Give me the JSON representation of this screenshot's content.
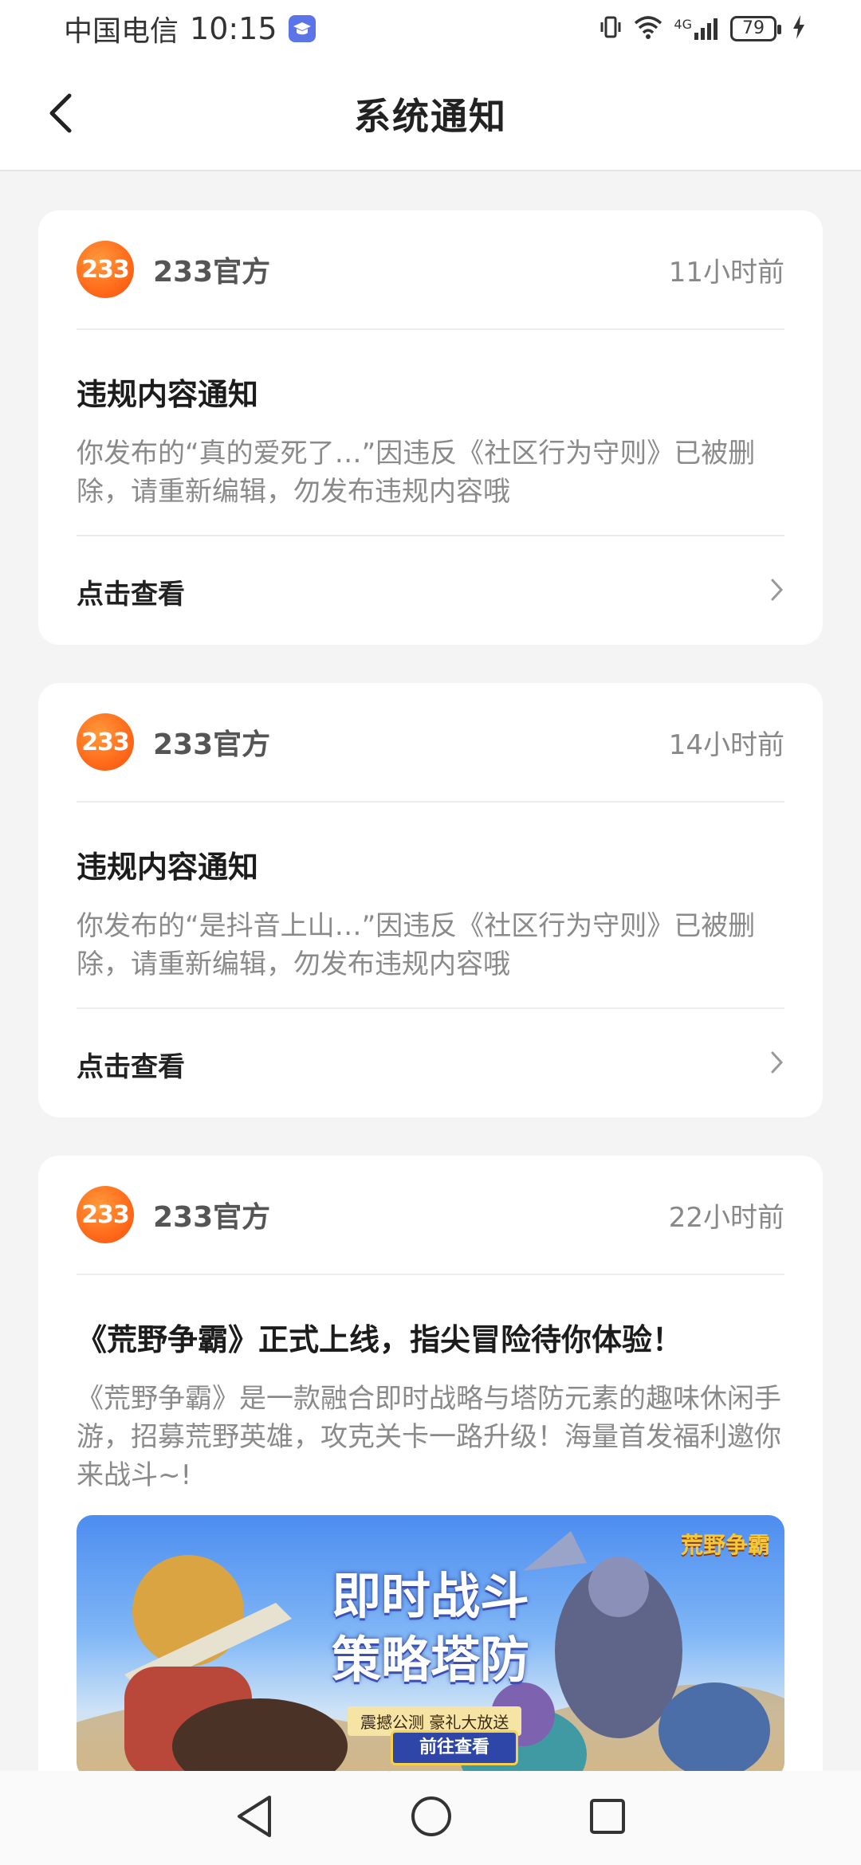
{
  "status_bar": {
    "carrier": "中国电信",
    "time": "10:15",
    "network": "4G",
    "battery": "79"
  },
  "header": {
    "title": "系统通知"
  },
  "notifications": [
    {
      "avatar_text": "233",
      "sender": "233官方",
      "time_ago": "11小时前",
      "title": "违规内容通知",
      "body": "你发布的“真的爱死了…”因违反《社区行为守则》已被删除，请重新编辑，勿发布违规内容哦",
      "action": "点击查看"
    },
    {
      "avatar_text": "233",
      "sender": "233官方",
      "time_ago": "14小时前",
      "title": "违规内容通知",
      "body": "你发布的“是抖音上山…”因违反《社区行为守则》已被删除，请重新编辑，勿发布违规内容哦",
      "action": "点击查看"
    },
    {
      "avatar_text": "233",
      "sender": "233官方",
      "time_ago": "22小时前",
      "title": "《荒野争霸》正式上线，指尖冒险待你体验！",
      "body": "《荒野争霸》是一款融合即时战略与塔防元素的趣味休闲手游，招募荒野英雄，攻克关卡一路升级！海量首发福利邀你来战斗~!",
      "banner": {
        "title_line1": "即时战斗",
        "title_line2": "策略塔防",
        "subtitle": "震撼公测 豪礼大放送",
        "button": "前往查看",
        "logo": "荒野争霸"
      }
    }
  ],
  "colors": {
    "accent_orange": "#ff6a1a",
    "background": "#f4f4f4",
    "card": "#ffffff"
  },
  "nav": {
    "back_icon": "triangle-back-icon",
    "home_icon": "circle-home-icon",
    "recents_icon": "square-recents-icon"
  }
}
